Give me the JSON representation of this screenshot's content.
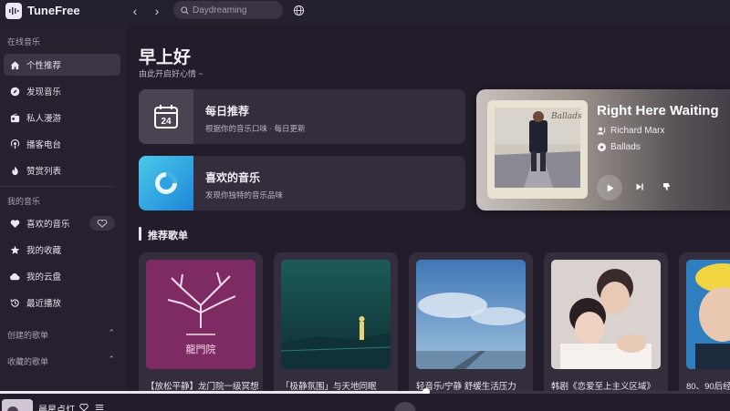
{
  "app": {
    "name": "TuneFree"
  },
  "search": {
    "placeholder": "Daydreaming"
  },
  "sidebar": {
    "section_online": "在线音乐",
    "section_mine": "我的音乐",
    "section_created": "创建的歌单",
    "section_collected": "收藏的歌单",
    "online_items": [
      {
        "label": "个性推荐",
        "icon": "home-icon"
      },
      {
        "label": "发现音乐",
        "icon": "compass-icon"
      },
      {
        "label": "私人漫游",
        "icon": "radio-icon"
      },
      {
        "label": "播客电台",
        "icon": "podcast-icon"
      },
      {
        "label": "赞赏列表",
        "icon": "flame-icon"
      }
    ],
    "mine_items": [
      {
        "label": "喜欢的音乐",
        "icon": "heart-icon"
      },
      {
        "label": "我的收藏",
        "icon": "star-icon"
      },
      {
        "label": "我的云盘",
        "icon": "cloud-icon"
      },
      {
        "label": "最近播放",
        "icon": "history-icon"
      }
    ]
  },
  "main": {
    "greeting": "早上好",
    "sub_greeting": "由此开启好心情 ~",
    "daily": {
      "title": "每日推荐",
      "subtitle": "根据你的音乐口味 · 每日更新",
      "day": "24"
    },
    "liked": {
      "title": "喜欢的音乐",
      "subtitle": "发现你独特的音乐品味"
    },
    "now_playing": {
      "title": "Right Here Waiting",
      "artist": "Richard Marx",
      "album": "Ballads",
      "cover_text": "Ballads"
    },
    "section_title": "推荐歌单",
    "playlists": [
      {
        "name": "【放松平静】龙门院一级冥想",
        "cover_text": "龍門院"
      },
      {
        "name": "「极静氛围」与天地同眠"
      },
      {
        "name": "轻音乐/宁静 舒缓生活压力"
      },
      {
        "name": "韩剧《恋爱至上主义区域》"
      },
      {
        "name": "80、90后经典"
      }
    ]
  },
  "player": {
    "title": "晨星点灯",
    "progress": 0.584
  },
  "colors": {
    "background": "#221c2b",
    "sidebar": "#27212f",
    "card": "#342d3c",
    "liked_gradient_start": "#3fc2e6",
    "liked_gradient_end": "#1e86d9"
  }
}
